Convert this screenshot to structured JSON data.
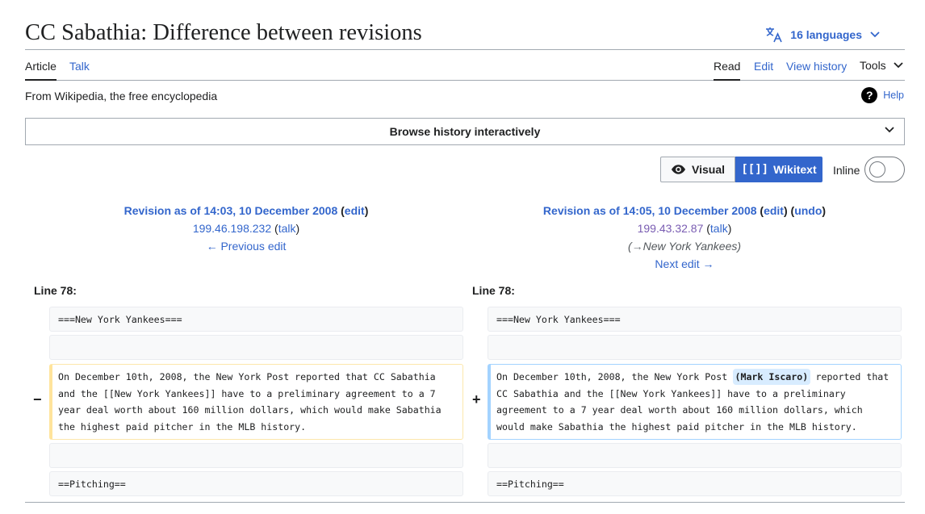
{
  "page": {
    "title": "CC Sabathia: Difference between revisions",
    "languages_label": "16 languages",
    "tagline": "From Wikipedia, the free encyclopedia",
    "help_label": "Help"
  },
  "tabs": {
    "article": "Article",
    "talk": "Talk",
    "read": "Read",
    "edit": "Edit",
    "view_history": "View history",
    "tools": "Tools"
  },
  "browse_history": "Browse history interactively",
  "view_toggle": {
    "visual": "Visual",
    "wikitext_icon": "[[]]",
    "wikitext": "Wikitext",
    "inline": "Inline"
  },
  "old_revision": {
    "title": "Revision as of 14:03, 10 December 2008",
    "edit_label": "edit",
    "user": "199.46.198.232",
    "talk_label": "talk",
    "nav_label": "← Previous edit"
  },
  "new_revision": {
    "title": "Revision as of 14:05, 10 December 2008",
    "edit_label": "edit",
    "undo_label": "undo",
    "user": "199.43.32.87",
    "talk_label": "talk",
    "summary_arrow": "→",
    "summary_section": "New York Yankees",
    "nav_label": "Next edit →"
  },
  "diff": {
    "left_line": "Line 78:",
    "right_line": "Line 78:",
    "context_heading": "===New York Yankees===",
    "deleted_marker": "−",
    "added_marker": "+",
    "deleted_text": "On December 10th, 2008, the New York Post reported that CC Sabathia and the [[New York Yankees]] have to a preliminary agreement to a 7 year deal worth about 160 million dollars, which would make Sabathia the highest paid pitcher in the MLB history.",
    "added_before": "On December 10th, 2008, the New York Post ",
    "added_inserted": "(Mark Iscaro)",
    "added_after": " reported that CC Sabathia and the [[New York Yankees]] have to a preliminary agreement to a 7 year deal worth about 160 million dollars, which would make Sabathia the highest paid pitcher in the MLB history.",
    "context_footer": "==Pitching=="
  },
  "colors": {
    "link": "#3366cc",
    "visited_link": "#795cb2",
    "deleted_border": "#ffe49c",
    "added_border": "#a3d3ff",
    "inserted_highlight": "#d8ecff",
    "toggle_active": "#3366cc"
  }
}
